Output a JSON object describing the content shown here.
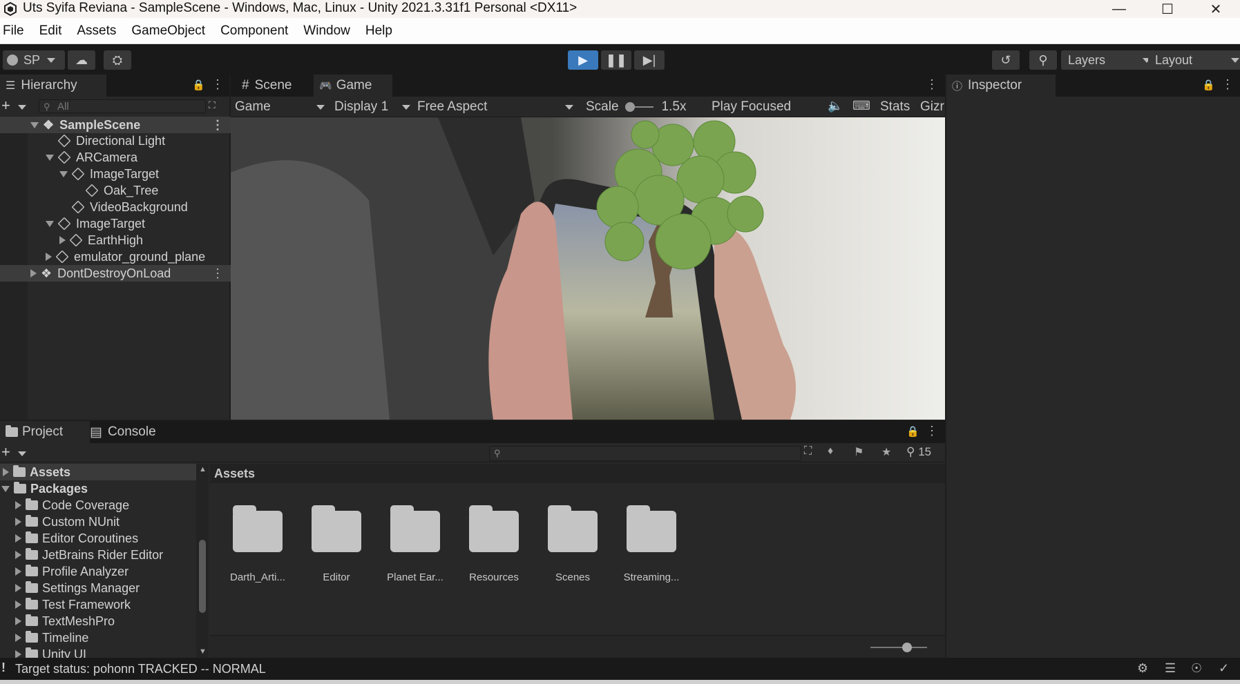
{
  "window": {
    "title": "Uts Syifa Reviana - SampleScene - Windows, Mac, Linux - Unity 2021.3.31f1 Personal <DX11>"
  },
  "menu": [
    "File",
    "Edit",
    "Assets",
    "GameObject",
    "Component",
    "Window",
    "Help"
  ],
  "toolbar": {
    "account": "SP",
    "layers": "Layers",
    "layout": "Layout"
  },
  "hierarchy": {
    "tab": "Hierarchy",
    "search_placeholder": "All",
    "items": [
      {
        "label": "SampleScene"
      },
      {
        "label": "Directional Light"
      },
      {
        "label": "ARCamera"
      },
      {
        "label": "ImageTarget"
      },
      {
        "label": "Oak_Tree"
      },
      {
        "label": "VideoBackground"
      },
      {
        "label": "ImageTarget"
      },
      {
        "label": "EarthHigh"
      },
      {
        "label": "emulator_ground_plane"
      },
      {
        "label": "DontDestroyOnLoad"
      }
    ]
  },
  "center_tabs": {
    "scene": "Scene",
    "game": "Game"
  },
  "game_toolbar": {
    "view": "Game",
    "display": "Display 1",
    "aspect": "Free Aspect",
    "scale_label": "Scale",
    "scale_value": "1.5x",
    "play_mode": "Play Focused",
    "stats": "Stats",
    "gizmos": "Gizr"
  },
  "inspector": {
    "tab": "Inspector"
  },
  "bottom_tabs": {
    "project": "Project",
    "console": "Console"
  },
  "project": {
    "hidden_count": "15",
    "breadcrumb": "Assets",
    "tree": [
      {
        "label": "Assets"
      },
      {
        "label": "Packages"
      },
      {
        "label": "Code Coverage"
      },
      {
        "label": "Custom NUnit"
      },
      {
        "label": "Editor Coroutines"
      },
      {
        "label": "JetBrains Rider Editor"
      },
      {
        "label": "Profile Analyzer"
      },
      {
        "label": "Settings Manager"
      },
      {
        "label": "Test Framework"
      },
      {
        "label": "TextMeshPro"
      },
      {
        "label": "Timeline"
      },
      {
        "label": "Unity UI"
      }
    ],
    "assets": [
      {
        "label": "Darth_Arti..."
      },
      {
        "label": "Editor"
      },
      {
        "label": "Planet Ear..."
      },
      {
        "label": "Resources"
      },
      {
        "label": "Scenes"
      },
      {
        "label": "Streaming..."
      }
    ]
  },
  "status": {
    "text": "Target status: pohonn TRACKED -- NORMAL"
  }
}
